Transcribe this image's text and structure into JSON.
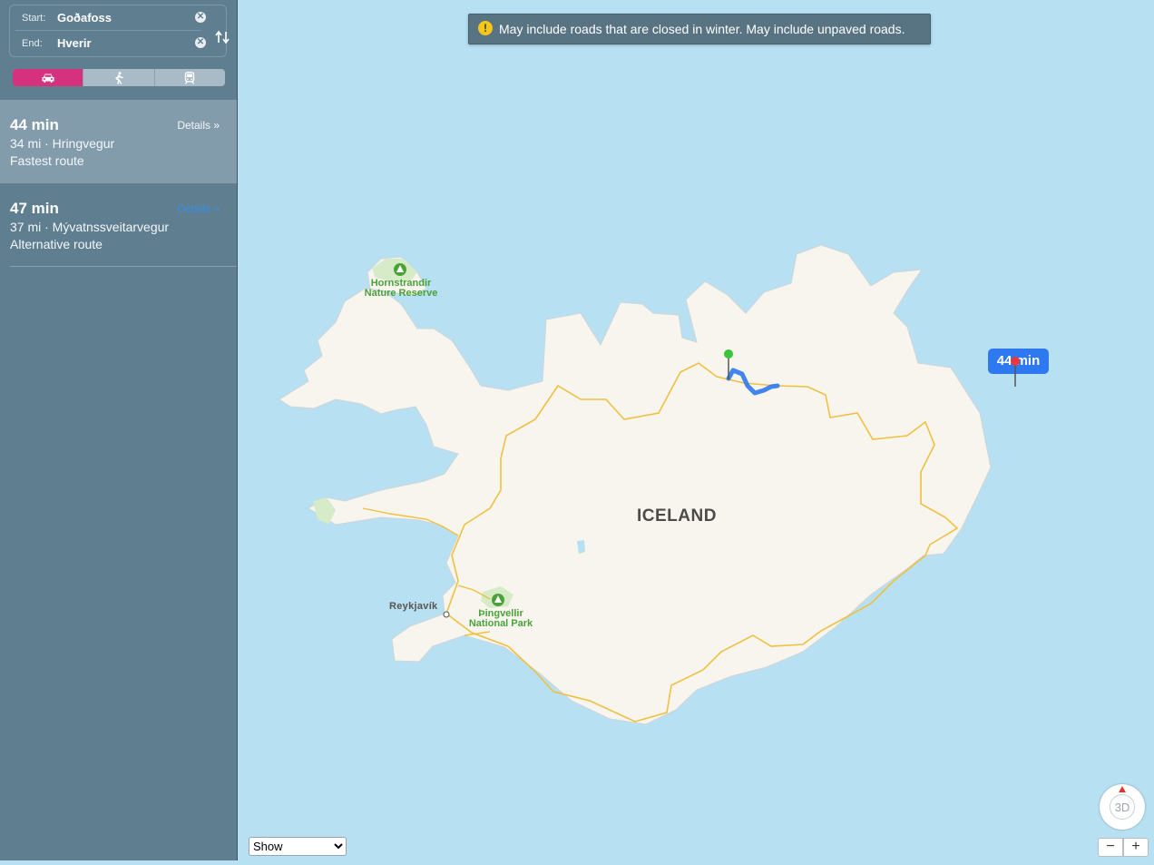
{
  "route_entry": {
    "start_label": "Start:",
    "start_value": "Goðafoss",
    "end_label": "End:",
    "end_value": "Hverir"
  },
  "transport_modes": [
    {
      "icon": "car-icon",
      "active": true
    },
    {
      "icon": "walking-icon",
      "active": false
    },
    {
      "icon": "train-icon",
      "active": false
    }
  ],
  "routes": [
    {
      "time": "44 min",
      "distance": "34 mi · Hringvegur",
      "note": "Fastest route",
      "details": "Details »",
      "selected": true
    },
    {
      "time": "47 min",
      "distance": "37 mi · Mývatnssveitarvegur",
      "note": "Alternative route",
      "details": "Details »",
      "selected": false
    }
  ],
  "map": {
    "banner": "May include roads that are closed in winter. May include unpaved roads.",
    "country_label": "ICELAND",
    "city_label": "Reykjavík",
    "park_labels": [
      "Hornstrandir Nature Reserve",
      "Þingvellir National Park"
    ],
    "route_callout": "44 min",
    "show_select": "Show",
    "compass_label": "3D",
    "zoom_out": "−",
    "zoom_in": "+"
  },
  "colors": {
    "sidebar": "#5f7e90",
    "selected_route": "#839cac",
    "active_mode": "#d5317e",
    "water": "#b7e0f3",
    "land": "#f7f5ee",
    "roads": "#f0c040",
    "route_line": "#2f79f0"
  }
}
